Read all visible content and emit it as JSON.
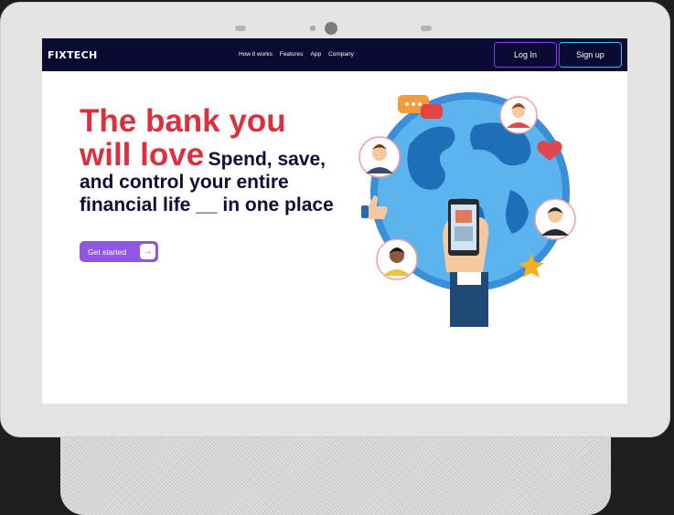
{
  "nav": {
    "logo": "FIXTECH",
    "links": [
      "How it works",
      "Features",
      "App",
      "Company"
    ],
    "login_label": "Log In",
    "signup_label": "Sign up"
  },
  "hero": {
    "title": "The bank you will love",
    "subtitle": "Spend, save, and control your entire financial life __ in one place",
    "cta_label": "Get started",
    "cta_icon": "arrow-right-icon"
  },
  "colors": {
    "nav_bg": "#0a0a32",
    "title_red": "#d9323e",
    "subtitle_navy": "#0d0d3a",
    "cta_purple": "#9157e3"
  }
}
